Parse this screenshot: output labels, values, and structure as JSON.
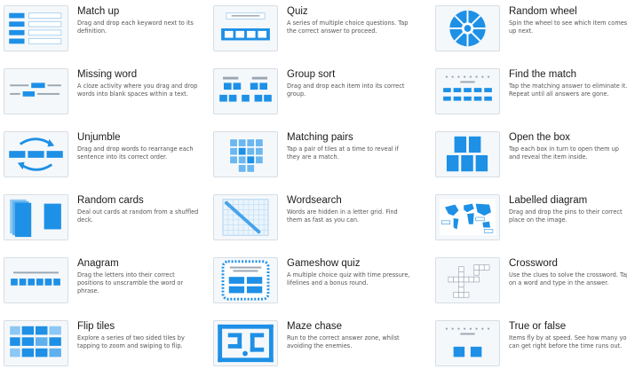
{
  "accent": "#1e90e6",
  "accent_light": "#8cc8f5",
  "templates": [
    {
      "title": "Match up",
      "desc": "Drag and drop each keyword next to its definition.",
      "icon": "match-up-icon"
    },
    {
      "title": "Quiz",
      "desc": "A series of multiple choice questions. Tap the correct answer to proceed.",
      "icon": "quiz-icon"
    },
    {
      "title": "Random wheel",
      "desc": "Spin the wheel to see which item comes up next.",
      "icon": "random-wheel-icon"
    },
    {
      "title": "Missing word",
      "desc": "A cloze activity where you drag and drop words into blank spaces within a text.",
      "icon": "missing-word-icon"
    },
    {
      "title": "Group sort",
      "desc": "Drag and drop each item into its correct group.",
      "icon": "group-sort-icon"
    },
    {
      "title": "Find the match",
      "desc": "Tap the matching answer to eliminate it. Repeat until all answers are gone.",
      "icon": "find-the-match-icon"
    },
    {
      "title": "Unjumble",
      "desc": "Drag and drop words to rearrange each sentence into its correct order.",
      "icon": "unjumble-icon"
    },
    {
      "title": "Matching pairs",
      "desc": "Tap a pair of tiles at a time to reveal if they are a match.",
      "icon": "matching-pairs-icon"
    },
    {
      "title": "Open the box",
      "desc": "Tap each box in turn to open them up and reveal the item inside.",
      "icon": "open-the-box-icon"
    },
    {
      "title": "Random cards",
      "desc": "Deal out cards at random from a shuffled deck.",
      "icon": "random-cards-icon"
    },
    {
      "title": "Wordsearch",
      "desc": "Words are hidden in a letter grid. Find them as fast as you can.",
      "icon": "wordsearch-icon"
    },
    {
      "title": "Labelled diagram",
      "desc": "Drag and drop the pins to their correct place on the image.",
      "icon": "labelled-diagram-icon"
    },
    {
      "title": "Anagram",
      "desc": "Drag the letters into their correct positions to unscramble the word or phrase.",
      "icon": "anagram-icon"
    },
    {
      "title": "Gameshow quiz",
      "desc": "A multiple choice quiz with time pressure, lifelines and a bonus round.",
      "icon": "gameshow-quiz-icon"
    },
    {
      "title": "Crossword",
      "desc": "Use the clues to solve the crossword. Tap on a word and type in the answer.",
      "icon": "crossword-icon"
    },
    {
      "title": "Flip tiles",
      "desc": "Explore a series of two sided tiles by tapping to zoom and swiping to flip.",
      "icon": "flip-tiles-icon"
    },
    {
      "title": "Maze chase",
      "desc": "Run to the correct answer zone, whilst avoiding the enemies.",
      "icon": "maze-chase-icon"
    },
    {
      "title": "True or false",
      "desc": "Items fly by at speed. See how many you can get right before the time runs out.",
      "icon": "true-or-false-icon"
    }
  ]
}
